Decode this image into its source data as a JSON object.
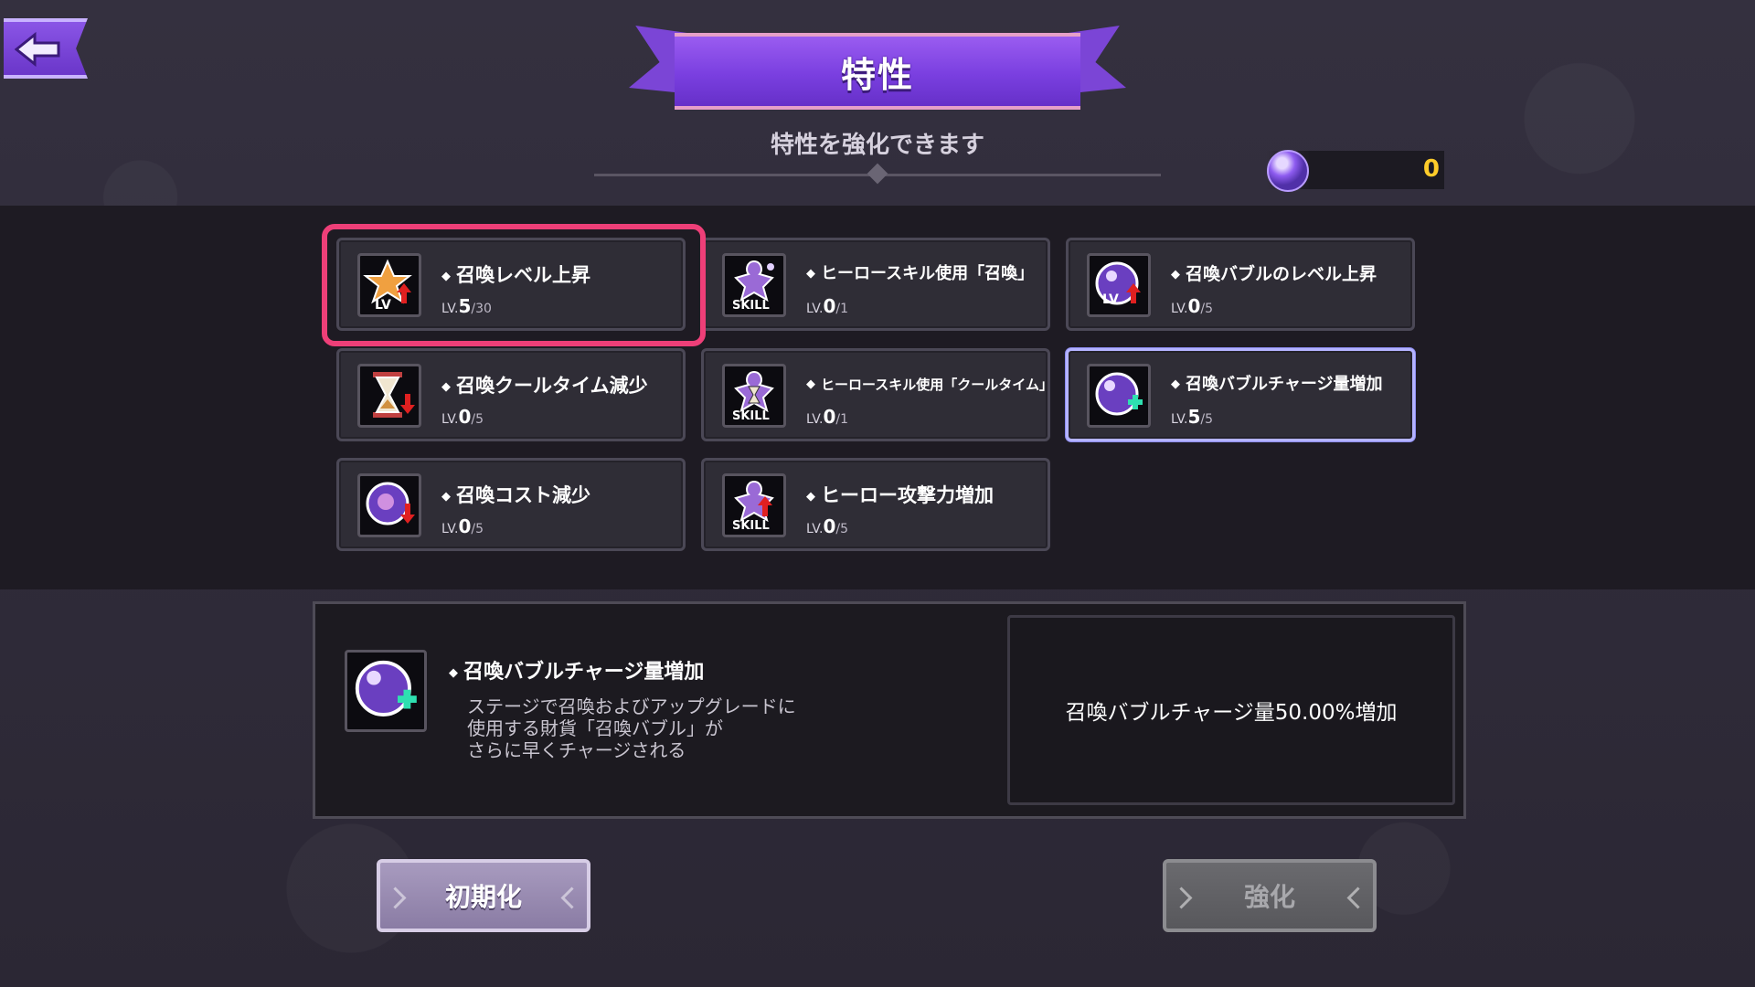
{
  "header": {
    "title": "特性",
    "subtitle": "特性を強化できます"
  },
  "currency": {
    "value": "0",
    "icon": "summon-bubble-icon"
  },
  "traits": [
    {
      "title": "召喚レベル上昇",
      "lv_prefix": "LV.",
      "level": "5",
      "max": "/30",
      "icon": "star-level-up-icon"
    },
    {
      "title": "ヒーロースキル使用「召喚」",
      "lv_prefix": "LV.",
      "level": "0",
      "max": "/1",
      "icon": "hero-skill-icon"
    },
    {
      "title": "召喚バブルのレベル上昇",
      "lv_prefix": "LV.",
      "level": "0",
      "max": "/5",
      "icon": "bubble-level-up-icon"
    },
    {
      "title": "召喚クールタイム減少",
      "lv_prefix": "LV.",
      "level": "0",
      "max": "/5",
      "icon": "hourglass-icon"
    },
    {
      "title": "ヒーロースキル使用「クールタイム」",
      "lv_prefix": "LV.",
      "level": "0",
      "max": "/1",
      "icon": "hero-skill-hourglass-icon"
    },
    {
      "title": "召喚バブルチャージ量増加",
      "lv_prefix": "LV.",
      "level": "5",
      "max": "/5",
      "icon": "bubble-plus-icon"
    },
    {
      "title": "召喚コスト減少",
      "lv_prefix": "LV.",
      "level": "0",
      "max": "/5",
      "icon": "bubble-cost-down-icon"
    },
    {
      "title": "ヒーロー攻撃力増加",
      "lv_prefix": "LV.",
      "level": "0",
      "max": "/5",
      "icon": "hero-attack-up-icon"
    }
  ],
  "detail": {
    "name": "召喚バブルチャージ量増加",
    "desc_lines": [
      "ステージで召喚およびアップグレードに",
      "使用する財貨「召喚バブル」が",
      "さらに早くチャージされる"
    ],
    "effect": "召喚バブルチャージ量50.00%増加"
  },
  "buttons": {
    "reset": "初期化",
    "enhance": "強化"
  },
  "colors": {
    "accent": "#7a3fe0",
    "highlight": "#ee3f78",
    "currency": "#ffcc2a"
  }
}
